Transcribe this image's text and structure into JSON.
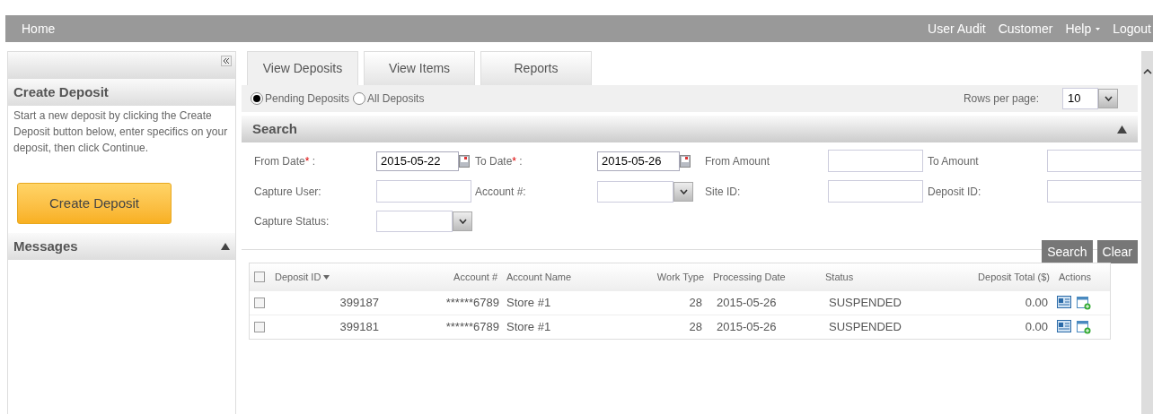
{
  "topbar": {
    "home": "Home",
    "links": [
      {
        "label": "User Audit",
        "dropdown": false
      },
      {
        "label": "Customer",
        "dropdown": false
      },
      {
        "label": "Help",
        "dropdown": true
      },
      {
        "label": "Logout",
        "dropdown": false
      }
    ]
  },
  "sidebar": {
    "title": "Create Deposit",
    "text": "Start a new deposit by clicking the Create Deposit button below, enter specifics on your deposit, then click Continue.",
    "button": "Create Deposit",
    "messages": "Messages"
  },
  "tabs": [
    {
      "label": "View Deposits",
      "selected": true
    },
    {
      "label": "View Items",
      "selected": false
    },
    {
      "label": "Reports",
      "selected": false
    }
  ],
  "filters": [
    {
      "label": "Pending Deposits",
      "selected": true
    },
    {
      "label": "All Deposits",
      "selected": false
    }
  ],
  "rows_per_page": {
    "label": "Rows per page:",
    "value": "10"
  },
  "search": {
    "title": "Search",
    "fields": [
      [
        {
          "label": "From Date",
          "required_mark": "*",
          "suffix": " :",
          "kind": "date",
          "value": "2015-05-22"
        },
        {
          "label": "To Date",
          "required_mark": "*",
          "suffix": " :",
          "kind": "date",
          "value": "2015-05-26"
        },
        {
          "label": "From Amount",
          "kind": "text"
        },
        {
          "label": "To Amount",
          "kind": "text"
        }
      ],
      [
        {
          "label": "Capture User:",
          "kind": "text"
        },
        {
          "label": "Account #:",
          "kind": "select"
        },
        {
          "label": "Site ID:",
          "kind": "text"
        },
        {
          "label": "Deposit ID:",
          "kind": "text"
        }
      ],
      [
        {
          "label": "Capture Status:",
          "kind": "select"
        }
      ]
    ],
    "buttons": [
      "Search",
      "Clear"
    ]
  },
  "table": {
    "all_checked": false,
    "columns": [
      "Deposit ID",
      "Account #",
      "Account Name",
      "Work Type",
      "Processing Date",
      "Status",
      "Deposit Total ($)",
      "Actions"
    ],
    "rows": [
      {
        "checked": false,
        "cells": [
          "399187",
          "******6789",
          "Store #1",
          "28",
          "2015-05-26",
          "SUSPENDED",
          "0.00"
        ]
      },
      {
        "checked": false,
        "cells": [
          "399181",
          "******6789",
          "Store #1",
          "28",
          "2015-05-26",
          "SUSPENDED",
          "0.00"
        ]
      }
    ]
  }
}
